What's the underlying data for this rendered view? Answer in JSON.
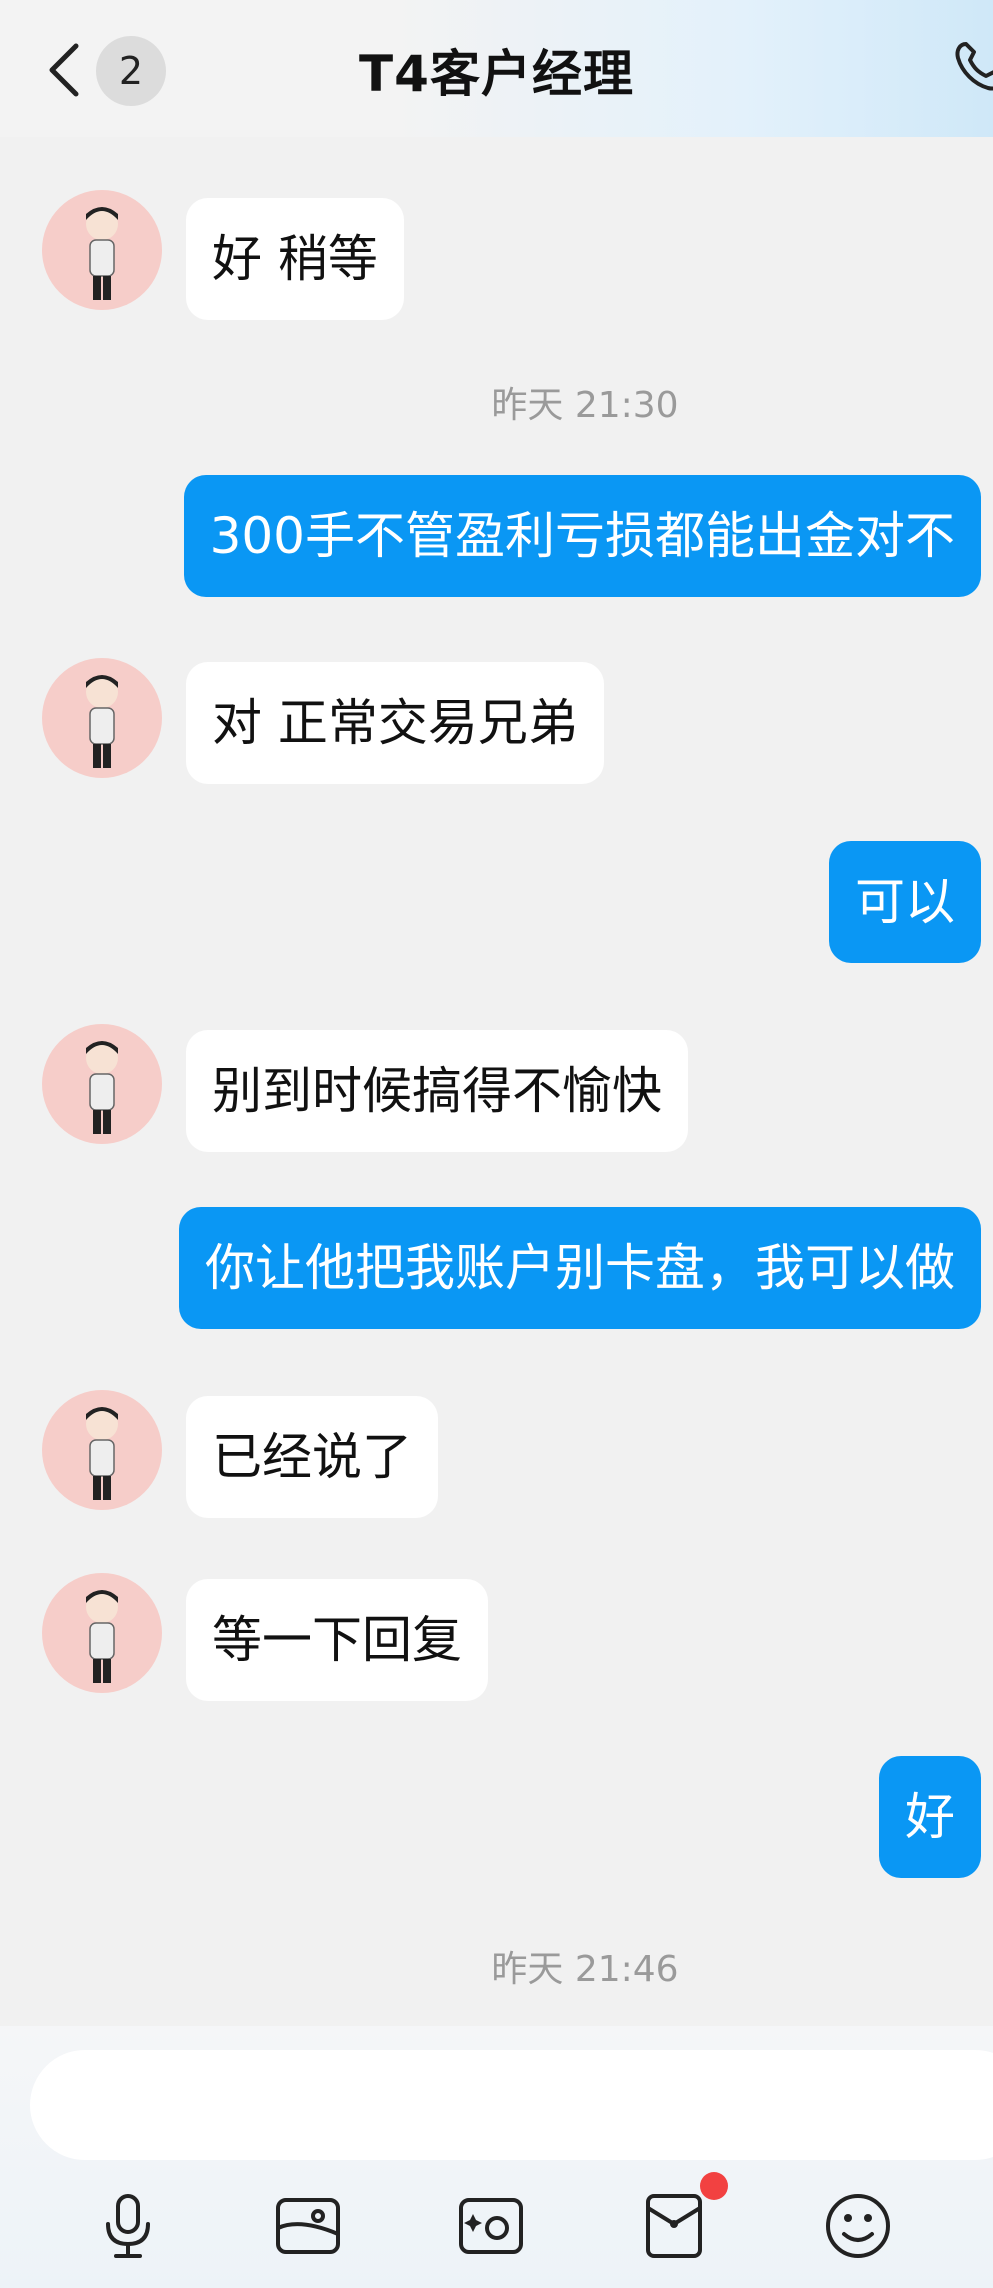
{
  "header": {
    "unread_count": "2",
    "title": "T4客户经理"
  },
  "messages": [
    {
      "side": "in",
      "text": "好 稍等"
    },
    {
      "type": "time",
      "text": "昨天 21:30"
    },
    {
      "side": "out",
      "text": "300手不管盈利亏损都能出金对不"
    },
    {
      "side": "in",
      "text": "对 正常交易兄弟"
    },
    {
      "side": "out",
      "text": "可以"
    },
    {
      "side": "in",
      "text": "别到时候搞得不愉快"
    },
    {
      "side": "out",
      "text": "你让他把我账户别卡盘，我可以做"
    },
    {
      "side": "in",
      "text": "已经说了"
    },
    {
      "side": "in",
      "text": "等一下回复"
    },
    {
      "side": "out",
      "text": "好"
    },
    {
      "type": "time",
      "text": "昨天 21:46"
    }
  ],
  "input": {
    "value": ""
  },
  "toolbar": {
    "icons": [
      "microphone-icon",
      "picture-icon",
      "camera-icon",
      "red-packet-icon",
      "emoji-icon"
    ],
    "notification_dot_color": "#f24141"
  },
  "colors": {
    "outgoing_bubble": "#0a97f4",
    "incoming_bubble": "#ffffff",
    "background": "#f1f1f1",
    "avatar_bg": "#f6cdc9"
  }
}
